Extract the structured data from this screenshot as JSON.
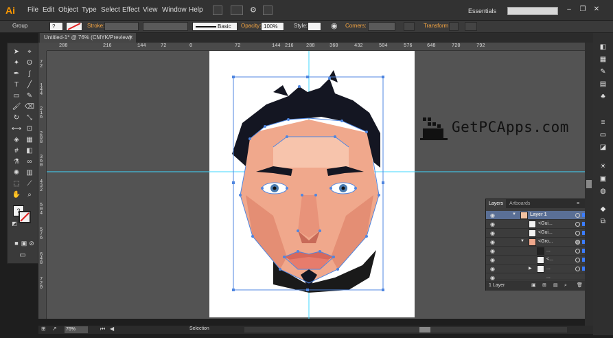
{
  "app": {
    "logo": "Ai"
  },
  "menu": [
    "File",
    "Edit",
    "Object",
    "Type",
    "Select",
    "Effect",
    "View",
    "Window",
    "Help"
  ],
  "workspace": "Essentials",
  "control_bar": {
    "selection_type": "Group",
    "stroke_label": "Stroke:",
    "brush": "Basic",
    "opacity_label": "Opacity:",
    "opacity_value": "100%",
    "style_label": "Style:",
    "corners_label": "Corners:",
    "transform_label": "Transform"
  },
  "document": {
    "tab_title": "Untitled-1* @ 76% (CMYK/Preview)"
  },
  "rulers": {
    "horizontal": [
      "288",
      "216",
      "144",
      "72",
      "0",
      "72",
      "144",
      "216",
      "288",
      "360",
      "432",
      "504",
      "576",
      "648",
      "720",
      "792"
    ],
    "vertical": [
      "7 2",
      "1 4 4",
      "2 1 6",
      "2 8 8",
      "3 6 0",
      "4 3 2",
      "5 0 4",
      "5 7 6",
      "6 4 8",
      "7 2 0"
    ]
  },
  "layers_panel": {
    "tabs": [
      "Layers",
      "Artboards"
    ],
    "rows": [
      {
        "name": "Layer 1",
        "selected": true
      },
      {
        "name": "<Gui...",
        "selected": false
      },
      {
        "name": "<Gui...",
        "selected": false
      },
      {
        "name": "<Gro...",
        "selected": false
      },
      {
        "name": "...",
        "selected": false
      },
      {
        "name": "<...",
        "selected": false
      },
      {
        "name": "...",
        "selected": false
      },
      {
        "name": "...",
        "selected": false
      }
    ],
    "footer": "1 Layer"
  },
  "status": {
    "zoom": "76%",
    "tool": "Selection"
  },
  "watermark": {
    "text": "GetPCApps.com"
  },
  "colors": {
    "accent": "#4f86e0",
    "guide": "#3fd7ff",
    "skin": "#f0a88c",
    "hair": "#141622",
    "lips": "#d8685a"
  }
}
